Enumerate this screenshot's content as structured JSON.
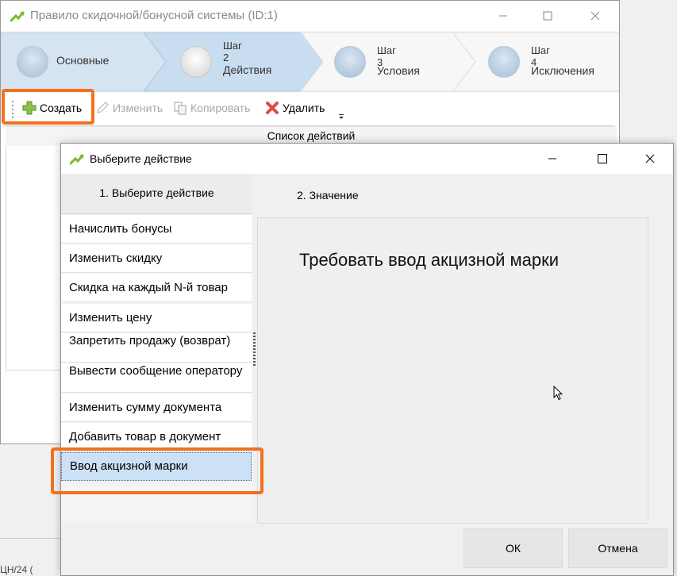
{
  "parent_window": {
    "title": "Правило скидочной/бонусной системы (ID:1)",
    "steps": [
      {
        "name": "Основные",
        "num": "",
        "active": false
      },
      {
        "name": "Действия",
        "num": "Шаг 2",
        "active": true
      },
      {
        "name": "Условия",
        "num": "Шаг 3",
        "active": false
      },
      {
        "name": "Исключения",
        "num": "Шаг 4",
        "active": false
      }
    ],
    "toolbar": {
      "create": "Создать",
      "edit": "Изменить",
      "copy": "Копировать",
      "delete": "Удалить"
    },
    "grid_header": "Список  действий",
    "bottom_fragment": "ЦН/24 ("
  },
  "dialog": {
    "title": "Выберите действие",
    "left_header": "1. Выберите  действие",
    "right_header": "2. Значение",
    "actions": [
      "Начислить бонусы",
      "Изменить скидку",
      "Скидка на каждый N-й товар",
      "Изменить цену",
      "Запретить продажу (возврат)",
      "Вывести сообщение оператору",
      "Изменить сумму документа",
      "Добавить товар в документ",
      "Ввод акцизной марки"
    ],
    "selected_index": 8,
    "value_text": "Требовать ввод акцизной марки",
    "ok_label": "ОК",
    "cancel_label": "Отмена"
  },
  "colors": {
    "highlight": "#f3701d",
    "selection": "#cce0f6",
    "wizard_active": "#c9ddf0"
  }
}
